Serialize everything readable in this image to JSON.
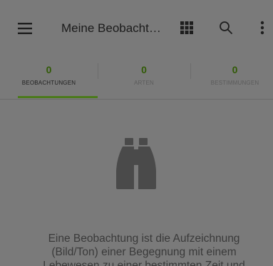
{
  "app": {
    "title": "Meine Beobachtu…"
  },
  "icons": {
    "menu": "hamburger-menu-icon",
    "grid": "grid-view-icon",
    "search": "search-icon",
    "more": "more-vert-icon",
    "empty": "binoculars-icon"
  },
  "tabs": [
    {
      "count": "0",
      "label": "BEOBACHTUNGEN",
      "active": true
    },
    {
      "count": "0",
      "label": "ARTEN",
      "active": false
    },
    {
      "count": "0",
      "label": "BESTIMMUNGEN",
      "active": false
    }
  ],
  "empty_state": {
    "line1": "Eine Beobachtung ist die Aufzeichnung",
    "line2": "(Bild/Ton) einer Begegnung mit einem",
    "line3": "Lebewesen zu einer bestimmten Zeit und"
  },
  "colors": {
    "accent": "#4b7a1b",
    "count": "#315a06",
    "background": "#7a7a7a"
  }
}
